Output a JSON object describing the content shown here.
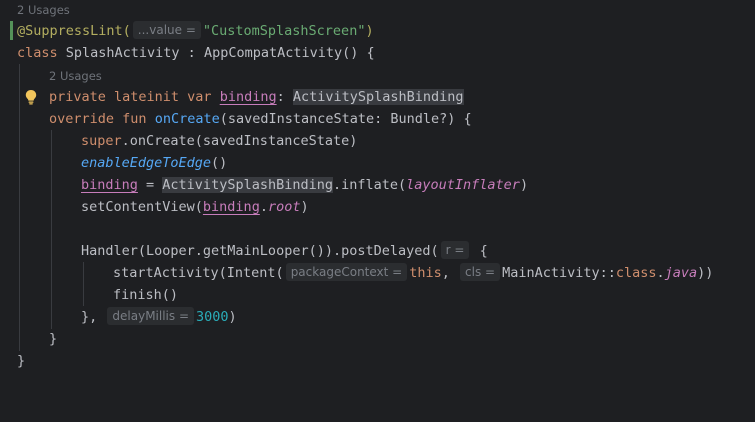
{
  "editor": {
    "usages_top": "2 Usages",
    "usages_field": "2 Usages",
    "hints": {
      "value": "...value =",
      "r": "r =",
      "package_context": "packageContext =",
      "cls": "cls =",
      "delay_millis": "delayMillis ="
    },
    "tokens": {
      "at_suppress": "@SuppressLint(",
      "suppress_str": "\"CustomSplashScreen\"",
      "close_paren": ")",
      "kw_class": "class",
      "class_decl": " SplashActivity : AppCompatActivity() {",
      "kw_private_lateinit_var": "private lateinit var",
      "space": " ",
      "binding": "binding",
      "colon_space": ": ",
      "activity_splash_binding": "ActivitySplashBinding",
      "kw_override_fun": "override fun",
      "on_create": "onCreate",
      "on_create_params": "(savedInstanceState: Bundle?) {",
      "kw_super": "super",
      "super_call": ".onCreate(savedInstanceState)",
      "enable_edge": "enableEdgeToEdge",
      "parens": "()",
      "assign": " = ",
      "inflate_open": ".inflate(",
      "layout_inflater": "layoutInflater",
      "set_content_view_open": "setContentView(",
      "dot": ".",
      "root": "root",
      "handler_call": "Handler(Looper.getMainLooper()).postDelayed(",
      "lambda_open": " {",
      "start_activity_open": "startActivity(Intent(",
      "kw_this": "this",
      "comma_space": ", ",
      "main_activity": "MainActivity::",
      "kw_class_ref": "class",
      "java": "java",
      "double_close": "))",
      "finish_call": "finish()",
      "lambda_close": "},",
      "delay_value": "3000",
      "close_brace": "}"
    }
  }
}
